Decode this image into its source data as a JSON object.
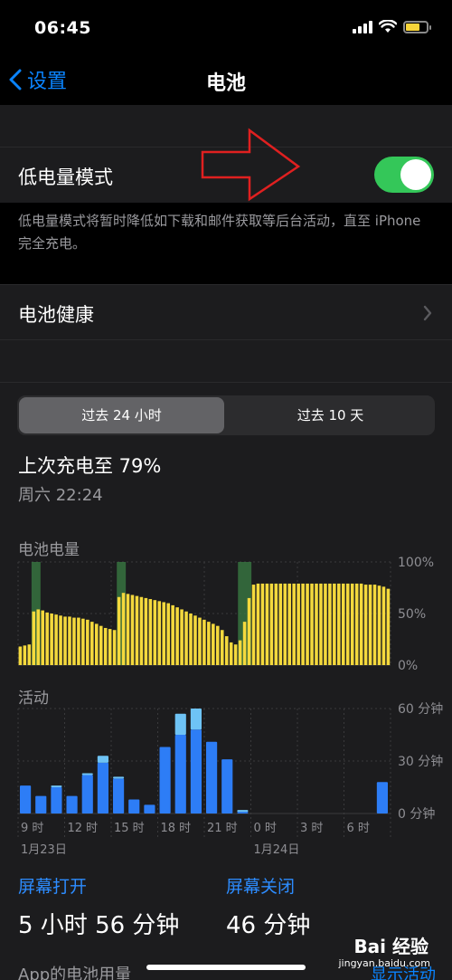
{
  "status_bar": {
    "time": "06:45"
  },
  "nav": {
    "back_label": "设置",
    "title": "电池"
  },
  "low_power": {
    "label": "低电量模式",
    "enabled": true,
    "footnote": "低电量模式将暂时降低如下载和邮件获取等后台活动，直至 iPhone 完全充电。"
  },
  "battery_health": {
    "label": "电池健康"
  },
  "segmented": {
    "options": [
      "过去 24 小时",
      "过去 10 天"
    ],
    "selected": 0
  },
  "last_charge": {
    "text": "上次充电至 79%",
    "time": "周六 22:24"
  },
  "chart_data": [
    {
      "type": "bar",
      "title": "电池电量",
      "y_ticks": [
        "100%",
        "50%",
        "0%"
      ],
      "ylim": [
        0,
        100
      ],
      "unit": "%",
      "values": [
        18,
        19,
        20,
        52,
        54,
        53,
        51,
        50,
        49,
        48,
        47,
        47,
        46,
        46,
        45,
        44,
        42,
        40,
        38,
        36,
        35,
        34,
        66,
        70,
        69,
        68,
        67,
        66,
        65,
        64,
        63,
        62,
        61,
        60,
        58,
        56,
        54,
        52,
        50,
        48,
        46,
        44,
        42,
        40,
        38,
        34,
        28,
        22,
        20,
        24,
        42,
        65,
        78,
        79,
        79,
        79,
        79,
        79,
        79,
        79,
        79,
        79,
        79,
        79,
        79,
        79,
        79,
        79,
        79,
        79,
        79,
        79,
        79,
        79,
        79,
        79,
        79,
        78,
        78,
        78,
        77,
        76,
        74
      ],
      "charging_ranges": [
        [
          3,
          5
        ],
        [
          22,
          24
        ],
        [
          49,
          52
        ]
      ],
      "colors": {
        "bar": "#f4d93d",
        "charging": "#3a7d44"
      }
    },
    {
      "type": "bar",
      "title": "活动",
      "y_ticks": [
        "60 分钟",
        "30 分钟",
        "0 分钟"
      ],
      "ylim": [
        0,
        60
      ],
      "unit": "分钟",
      "x_ticks": [
        "9 时",
        "12 时",
        "15 时",
        "18 时",
        "21 时",
        "0 时",
        "3 时",
        "6 时"
      ],
      "date_labels": [
        "1月23日",
        "1月24日"
      ],
      "series": [
        {
          "name": "屏幕打开",
          "values": [
            16,
            10,
            15,
            10,
            22,
            29,
            20,
            8,
            5,
            38,
            45,
            48,
            41,
            31,
            1,
            0,
            0,
            0,
            0,
            0,
            0,
            0,
            0,
            18
          ]
        },
        {
          "name": "屏幕关闭",
          "values": [
            0,
            0,
            1,
            0,
            1,
            4,
            1,
            0,
            0,
            0,
            12,
            12,
            0,
            0,
            1,
            0,
            0,
            0,
            0,
            0,
            0,
            0,
            0,
            0
          ]
        }
      ],
      "colors": {
        "screen_on": "#2d7df6",
        "screen_off": "#6ec3f5"
      }
    }
  ],
  "stats": {
    "screen_on_label": "屏幕打开",
    "screen_on_value": "5 小时 56 分钟",
    "screen_off_label": "屏幕关闭",
    "screen_off_value": "46 分钟"
  },
  "bottom": {
    "app_usage_label": "App的电池用量",
    "show_activity": "显示活动"
  },
  "watermark": {
    "brand": "Bai 经验",
    "url": "jingyan.baidu.com"
  }
}
